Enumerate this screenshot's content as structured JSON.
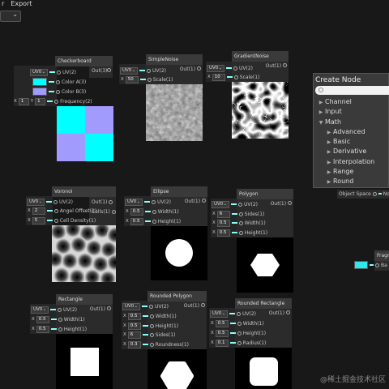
{
  "menu": {
    "item1": "r",
    "item2": "Export"
  },
  "create_node": {
    "title": "Create Node",
    "search_placeholder": "",
    "items": [
      {
        "label": "Channel",
        "level": 0,
        "expanded": false
      },
      {
        "label": "Input",
        "level": 0,
        "expanded": false
      },
      {
        "label": "Math",
        "level": 0,
        "expanded": true
      },
      {
        "label": "Advanced",
        "level": 1,
        "expanded": false
      },
      {
        "label": "Basic",
        "level": 1,
        "expanded": false
      },
      {
        "label": "Derivative",
        "level": 1,
        "expanded": false
      },
      {
        "label": "Interpolation",
        "level": 1,
        "expanded": false
      },
      {
        "label": "Range",
        "level": 1,
        "expanded": false
      },
      {
        "label": "Round",
        "level": 1,
        "expanded": false
      }
    ]
  },
  "object_space": {
    "label": "Object Space",
    "out": "No"
  },
  "fragment": {
    "title": "Fragm",
    "port": "Ba",
    "color": "#2ee8ea"
  },
  "nodes": {
    "checkerboard": {
      "title": "Checkerboard",
      "out": "Out(3)",
      "uv": "UV0",
      "uv_label": "UV(2)",
      "color_a_label": "Color A(3)",
      "color_a": "#00ffff",
      "color_b_label": "Color B(3)",
      "color_b": "#a29bfe",
      "freq_x_label": "X",
      "freq_x": "1",
      "freq_y_label": "Y",
      "freq_y": "1",
      "freq_label": "Frequency(2)"
    },
    "simple_noise": {
      "title": "SimpleNoise",
      "out": "Out(1)",
      "uv": "UV0",
      "uv_label": "UV(2)",
      "x_label": "X",
      "scale": "50",
      "scale_label": "Scale(1)"
    },
    "gradient_noise": {
      "title": "GradientNoise",
      "out": "Out(1)",
      "uv": "UV0",
      "uv_label": "UV(2)",
      "x_label": "X",
      "scale": "10",
      "scale_label": "Scale(1)"
    },
    "voronoi": {
      "title": "Voronoi",
      "out": "Out(1)",
      "out2": "Cells(1)",
      "uv": "UV0",
      "uv_label": "UV(2)",
      "x_label": "X",
      "angle": "2",
      "angle_label": "Angel Offset(1)",
      "density": "5",
      "density_label": "Cell Density(1)"
    },
    "ellipse": {
      "title": "Ellipse",
      "out": "Out(1)",
      "uv": "UV0",
      "uv_label": "UV(2)",
      "x_label": "X",
      "width": "0.5",
      "width_label": "Width(1)",
      "height": "0.5",
      "height_label": "Height(1)"
    },
    "polygon": {
      "title": "Polygon",
      "out": "Out(1)",
      "uv": "UV0",
      "uv_label": "UV(2)",
      "x_label": "X",
      "sides": "6",
      "sides_label": "Sides(1)",
      "width": "0.5",
      "width_label": "Width(1)",
      "height": "0.5",
      "height_label": "Height(1)"
    },
    "rectangle": {
      "title": "Rectangle",
      "out": "Out(1)",
      "uv": "UV0",
      "uv_label": "UV(2)",
      "x_label": "X",
      "width": "0.5",
      "width_label": "Width(1)",
      "height": "0.5",
      "height_label": "Height(1)"
    },
    "rounded_polygon": {
      "title": "Rounded Polygon",
      "out": "Out(1)",
      "uv": "UV0",
      "uv_label": "UV(2)",
      "x_label": "X",
      "width": "0.5",
      "width_label": "Width(1)",
      "height": "0.5",
      "height_label": "Height(1)",
      "sides": "6",
      "sides_label": "Sides(1)",
      "roundness": "0.3",
      "roundness_label": "Roundness(1)"
    },
    "rounded_rectangle": {
      "title": "Rounded Rectangle",
      "out": "Out(1)",
      "uv": "UV0",
      "uv_label": "UV(2)",
      "x_label": "X",
      "width": "0.5",
      "width_label": "Width(1)",
      "height": "0.5",
      "height_label": "Height(1)",
      "radius": "0.1",
      "radius_label": "Radius(1)"
    }
  },
  "watermark": "@稀土掘金技术社区"
}
